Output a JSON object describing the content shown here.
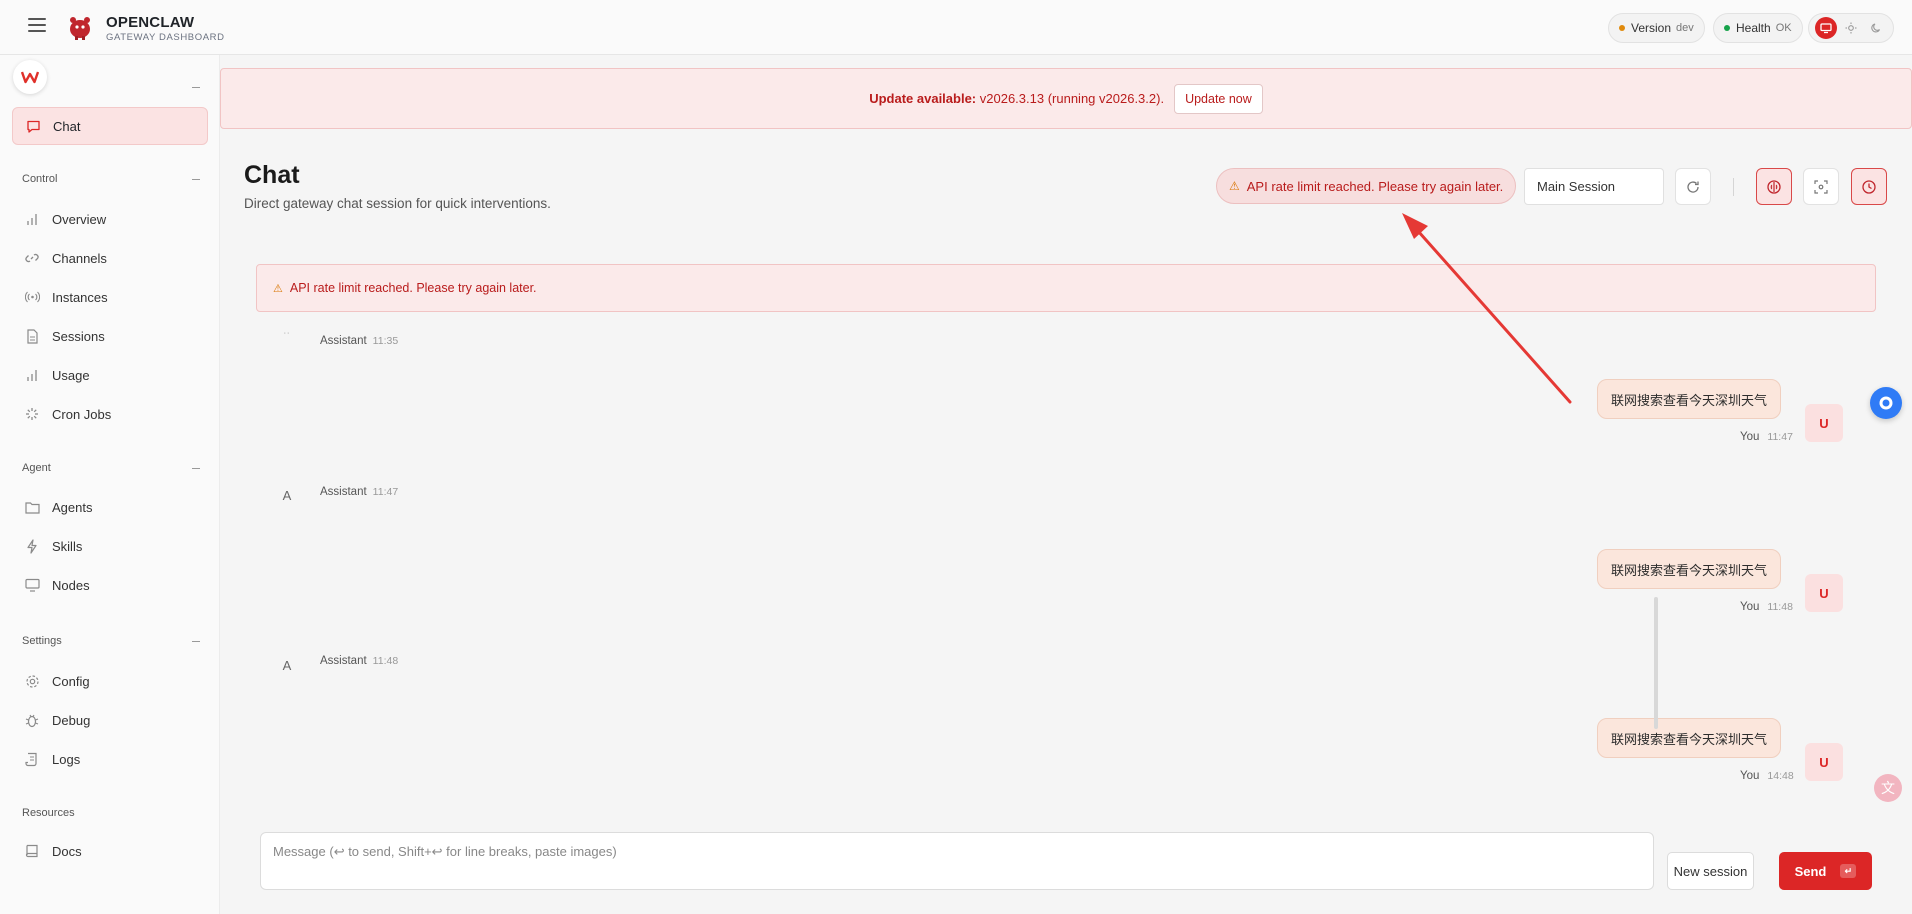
{
  "header": {
    "brand_title": "OPENCLAW",
    "brand_subtitle": "GATEWAY DASHBOARD",
    "version_label": "Version",
    "version_value": "dev",
    "health_label": "Health",
    "health_value": "OK"
  },
  "sidebar": {
    "items": [
      {
        "label": "Chat",
        "icon": "chat-icon",
        "active": true
      },
      {
        "label": "Overview",
        "icon": "bar-chart-icon"
      },
      {
        "label": "Channels",
        "icon": "link-icon"
      },
      {
        "label": "Instances",
        "icon": "broadcast-icon"
      },
      {
        "label": "Sessions",
        "icon": "document-icon"
      },
      {
        "label": "Usage",
        "icon": "bar-chart-icon"
      },
      {
        "label": "Cron Jobs",
        "icon": "loader-icon"
      },
      {
        "label": "Agents",
        "icon": "folder-icon"
      },
      {
        "label": "Skills",
        "icon": "bolt-icon"
      },
      {
        "label": "Nodes",
        "icon": "monitor-icon"
      },
      {
        "label": "Config",
        "icon": "gear-icon"
      },
      {
        "label": "Debug",
        "icon": "bug-icon"
      },
      {
        "label": "Logs",
        "icon": "scroll-icon"
      },
      {
        "label": "Docs",
        "icon": "book-icon"
      }
    ],
    "sections": {
      "control": "Control",
      "agent": "Agent",
      "settings": "Settings",
      "resources": "Resources"
    }
  },
  "banner": {
    "prefix": "Update available:",
    "text": "v2026.3.13 (running v2026.3.2).",
    "button": "Update now"
  },
  "page": {
    "title": "Chat",
    "subtitle": "Direct gateway chat session for quick interventions.",
    "rate_limit": "API rate limit reached. Please try again later.",
    "session": "Main Session"
  },
  "error": {
    "text": "API rate limit reached. Please try again later."
  },
  "messages": [
    {
      "role": "assistant",
      "name": "Assistant",
      "time": "11:35"
    },
    {
      "role": "user",
      "text": "联网搜索查看今天深圳天气",
      "name": "You",
      "time": "11:47",
      "avatar": "U"
    },
    {
      "role": "assistant",
      "name": "Assistant",
      "time": "11:47",
      "avatar": "A"
    },
    {
      "role": "user",
      "text": "联网搜索查看今天深圳天气",
      "name": "You",
      "time": "11:48",
      "avatar": "U"
    },
    {
      "role": "assistant",
      "name": "Assistant",
      "time": "11:48",
      "avatar": "A"
    },
    {
      "role": "user",
      "text": "联网搜索查看今天深圳天气",
      "name": "You",
      "time": "14:48",
      "avatar": "U"
    }
  ],
  "composer": {
    "placeholder": "Message (↩ to send, Shift+↩ for line breaks, paste images)",
    "new_session": "New session",
    "send": "Send",
    "send_key": "↵"
  },
  "colors": {
    "accent": "#dc2626",
    "banner_bg": "#fbeaea",
    "bubble_bg": "#fbe6dc"
  }
}
